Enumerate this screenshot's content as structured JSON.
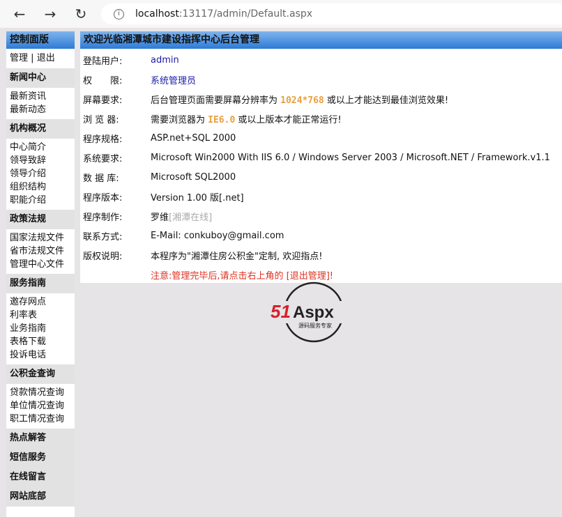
{
  "browser": {
    "url_host": "localhost",
    "url_path": ":13117/admin/Default.aspx",
    "back": "←",
    "forward": "→",
    "reload": "↻"
  },
  "sidebar": {
    "title": "控制面版",
    "manage": "管理",
    "sep": "|",
    "logout": "退出",
    "sections": [
      {
        "title": "新闻中心",
        "items": [
          "最新资讯",
          "最新动态"
        ]
      },
      {
        "title": "机构概况",
        "items": [
          "中心简介",
          "领导致辞",
          "领导介绍",
          "组织结构",
          "职能介绍"
        ]
      },
      {
        "title": "政策法规",
        "items": [
          "国家法规文件",
          "省市法规文件",
          "管理中心文件"
        ]
      },
      {
        "title": "服务指南",
        "items": [
          "邀存网点",
          "利率表",
          "业务指南",
          "表格下载",
          "投诉电话"
        ]
      },
      {
        "title": "公积金查询",
        "items": [
          "贷款情况查询",
          "单位情况查询",
          "职工情况查询"
        ]
      },
      {
        "title": "热点解答",
        "items": []
      },
      {
        "title": "短信服务",
        "items": []
      },
      {
        "title": "在线留言",
        "items": []
      },
      {
        "title": "网站底部",
        "items": []
      }
    ]
  },
  "main": {
    "title": "欢迎光临湘潭城市建设指挥中心后台管理",
    "user_label": "登陆用户:",
    "user": "admin",
    "role_label": "权　　限:",
    "role": "系统管理员",
    "screen_label": "屏幕要求:",
    "screen_pre": "后台管理页面需要屏幕分辨率为 ",
    "screen_res": "1024*768",
    "screen_post": " 或以上才能达到最佳浏览效果!",
    "browser_label": "浏 览 器:",
    "browser_pre": "需要浏览器为 ",
    "browser_ver": "IE6.0",
    "browser_post": " 或以上版本才能正常运行!",
    "spec_label": "程序规格:",
    "spec": "ASP.net+SQL 2000",
    "sys_label": "系统要求:",
    "sys": "Microsoft Win2000 With IIS 6.0 / Windows Server 2003 / Microsoft.NET / Framework.v1.1",
    "db_label": "数 据 库:",
    "db": "Microsoft SQL2000",
    "ver_label": "程序版本:",
    "ver": "Version 1.00 版[.net]",
    "author_label": "程序制作:",
    "author": "罗维",
    "author_site": "[湘潭在线]",
    "contact_label": "联系方式:",
    "contact": "E-Mail: conkuboy@gmail.com",
    "copy_label": "版权说明:",
    "copy": "本程序为\"湘潭住房公积金\"定制, 欢迎指点!",
    "notice": "注意:管理完毕后,请点击右上角的 [退出管理]!"
  },
  "logo": {
    "text1": "51",
    "text2": "Aspx",
    "sub": "源码服务专家"
  }
}
